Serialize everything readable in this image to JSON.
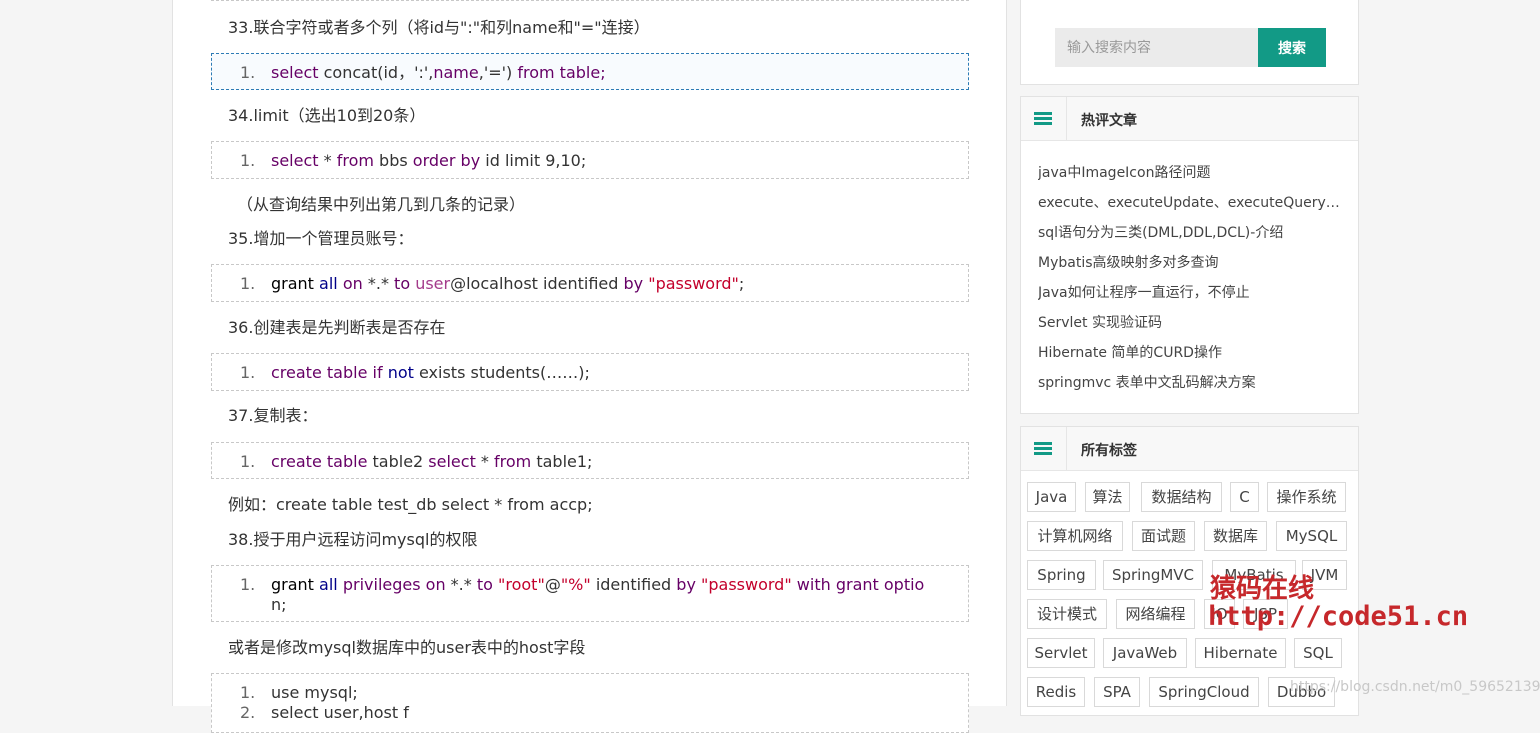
{
  "article": {
    "p33": "33.联合字符或者多个列（将id与\":\"和列name和\"=\"连接）",
    "p34": "34.limit（选出10到20条）",
    "p34_note": "（从查询结果中列出第几到几条的记录）",
    "p35": "35.增加一个管理员账号：",
    "p36": "36.创建表是先判断表是否存在",
    "p37": "37.复制表：",
    "p37_example": "例如：create table test_db select * from accp;",
    "p38": "38.授于用户远程访问mysql的权限",
    "p38_note": "或者是修改mysql数据库中的user表中的host字段",
    "line_no_1": "1.",
    "line_no_2": "2."
  },
  "code": {
    "c33": [
      "select",
      " concat(id，':',",
      "name",
      ",'=') ",
      "from",
      " table;"
    ],
    "c34": [
      "select",
      " * ",
      "from",
      " bbs ",
      "order",
      " ",
      "by",
      " id limit 9,10;"
    ],
    "c35": [
      "grant",
      " ",
      "all",
      " ",
      "on",
      " *.* ",
      "to",
      " ",
      "user",
      "@localhost identified ",
      "by",
      " ",
      "\"password\"",
      ";"
    ],
    "c36": [
      "create",
      " ",
      "table",
      " ",
      "if",
      " ",
      "not",
      " exists students(……);"
    ],
    "c37": [
      "create",
      " ",
      "table",
      " table2 ",
      "select",
      " * ",
      "from",
      " table1;"
    ],
    "c38": [
      "grant",
      " ",
      "all",
      " ",
      "privileges",
      " ",
      "on",
      " *.* ",
      "to",
      " ",
      "\"root\"",
      "@",
      "\"%\"",
      " identified ",
      "by",
      " ",
      "\"password\"",
      " ",
      "with",
      " ",
      "grant",
      " ",
      "optio"
    ],
    "c38_wrap": "n;",
    "c39_1": "use mysql;",
    "c39_2": "select user,host f"
  },
  "search": {
    "placeholder": "输入搜索内容",
    "button": "搜索"
  },
  "hot": {
    "title": "热评文章",
    "items": [
      "java中ImageIcon路径问题",
      "execute、executeUpdate、executeQuery三者的区别",
      "sql语句分为三类(DML,DDL,DCL)-介绍",
      "Mybatis高级映射多对多查询",
      "Java如何让程序一直运行，不停止",
      "Servlet 实现验证码",
      "Hibernate 简单的CURD操作",
      "springmvc 表单中文乱码解决方案"
    ]
  },
  "tags": {
    "title": "所有标签",
    "items": [
      "Java",
      "算法",
      "数据结构",
      "C",
      "操作系统",
      "计算机网络",
      "面试题",
      "数据库",
      "MySQL",
      "Spring",
      "SpringMVC",
      "MyBatis",
      "JVM",
      "设计模式",
      "网络编程",
      "IO",
      "JSP",
      "Servlet",
      "JavaWeb",
      "Hibernate",
      "SQL",
      "Redis",
      "SPA",
      "SpringCloud",
      "Dubbo"
    ]
  },
  "watermark": {
    "cn": "猿码在线",
    "url": "http://code51.cn",
    "csdn": "https://blog.csdn.net/m0_59652139"
  },
  "colors": {
    "accent": "#129a86",
    "keyword": "#660066",
    "keyword2": "#000088",
    "string": "#c3002b"
  }
}
